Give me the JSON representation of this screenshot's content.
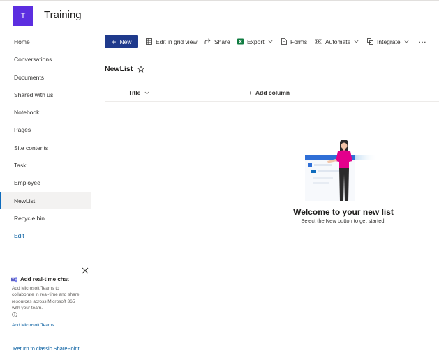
{
  "site": {
    "logo_letter": "T",
    "title": "Training"
  },
  "nav": {
    "items": [
      {
        "label": "Home"
      },
      {
        "label": "Conversations"
      },
      {
        "label": "Documents"
      },
      {
        "label": "Shared with us"
      },
      {
        "label": "Notebook"
      },
      {
        "label": "Pages"
      },
      {
        "label": "Site contents"
      },
      {
        "label": "Task"
      },
      {
        "label": "Employee"
      },
      {
        "label": "NewList",
        "selected": true
      },
      {
        "label": "Recycle bin"
      }
    ],
    "edit_label": "Edit"
  },
  "chat_panel": {
    "title": "Add real-time chat",
    "description": "Add Microsoft Teams to collaborate in real-time and share resources across Microsoft 365 with your team.",
    "link": "Add Microsoft Teams"
  },
  "classic_link": "Return to classic SharePoint",
  "command_bar": {
    "new_label": "New",
    "edit_grid_label": "Edit in grid view",
    "share_label": "Share",
    "export_label": "Export",
    "forms_label": "Forms",
    "automate_label": "Automate",
    "integrate_label": "Integrate",
    "more_label": "···"
  },
  "list": {
    "title": "NewList",
    "columns": {
      "title": "Title",
      "add_column": "Add column"
    },
    "empty_title": "Welcome to your new list",
    "empty_subtitle": "Select the New button to get started."
  },
  "colors": {
    "logo_bg": "#5c2ee0",
    "primary_button": "#1f3a8c",
    "link": "#005a9e",
    "selected_nav_bg": "#f3f2f1",
    "illustration_accent": "#e3008c",
    "export_icon_green": "#107c41"
  },
  "icons": {
    "grid": "grid-icon",
    "share": "share-icon",
    "export": "excel-icon",
    "forms": "forms-icon",
    "automate": "flow-icon",
    "integrate": "integrate-icon",
    "favorite": "star-icon",
    "close": "close-icon",
    "teams": "teams-icon",
    "info": "info-icon"
  }
}
